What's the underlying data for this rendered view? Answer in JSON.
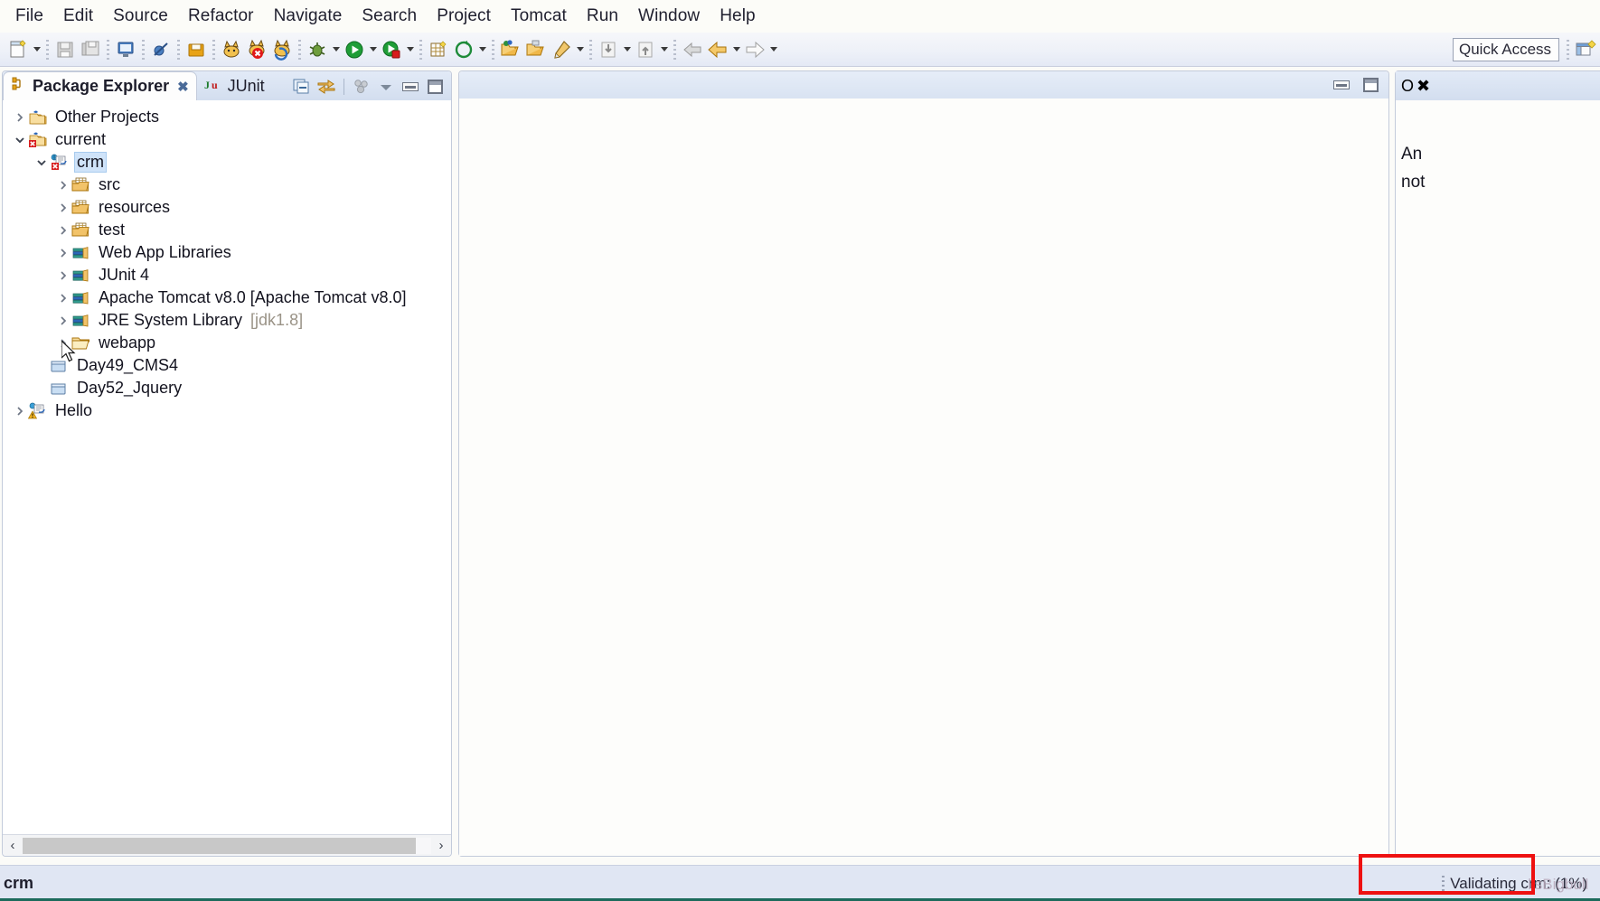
{
  "window": {
    "title_bar_visible": false
  },
  "menubar": {
    "items": [
      {
        "label": "File",
        "name": "menu-file"
      },
      {
        "label": "Edit",
        "name": "menu-edit"
      },
      {
        "label": "Source",
        "name": "menu-source"
      },
      {
        "label": "Refactor",
        "name": "menu-refactor"
      },
      {
        "label": "Navigate",
        "name": "menu-navigate"
      },
      {
        "label": "Search",
        "name": "menu-search"
      },
      {
        "label": "Project",
        "name": "menu-project"
      },
      {
        "label": "Tomcat",
        "name": "menu-tomcat"
      },
      {
        "label": "Run",
        "name": "menu-run"
      },
      {
        "label": "Window",
        "name": "menu-window"
      },
      {
        "label": "Help",
        "name": "menu-help"
      }
    ]
  },
  "toolbar": {
    "icons": [
      "new-wizard-icon",
      "dropdown-arrow",
      "separator",
      "save-icon",
      "save-all-icon",
      "separator",
      "open-console-icon",
      "separator",
      "skip-breakpoints-icon",
      "separator",
      "export-archive-icon",
      "separator",
      "tomcat-start-icon",
      "tomcat-stop-icon",
      "tomcat-restart-icon",
      "separator",
      "debug-icon",
      "dropdown-arrow",
      "run-icon",
      "dropdown-arrow",
      "run-server-icon",
      "dropdown-arrow",
      "separator",
      "new-java-package-icon",
      "new-java-class-icon",
      "dropdown-arrow",
      "separator",
      "open-type-icon",
      "open-task-icon",
      "search-icon",
      "dropdown-arrow",
      "separator",
      "previous-annotation-icon",
      "dropdown-arrow",
      "next-annotation-icon",
      "dropdown-arrow",
      "separator",
      "back-history-icon",
      "back-icon",
      "dropdown-arrow",
      "forward-icon",
      "dropdown-arrow"
    ],
    "quick_access": {
      "placeholder": "Quick Access",
      "value": "Quick Access"
    },
    "perspective_button": "open-perspective-icon"
  },
  "left_view": {
    "tabs": [
      {
        "label": "Package Explorer",
        "icon": "package-explorer-icon",
        "active": true,
        "closable": true,
        "close_glyph": "✖"
      },
      {
        "label": "JUnit",
        "icon": "junit-icon",
        "active": false,
        "closable": false
      }
    ],
    "toolbar_icons": [
      "collapse-all-icon",
      "link-with-editor-icon",
      "view-menu-icon",
      "minimize-icon",
      "maximize-icon"
    ],
    "tree": [
      {
        "label": "Other Projects",
        "indent": 0,
        "twisty": "collapsed",
        "icon": "java-project-group-icon",
        "selected": false
      },
      {
        "label": "current",
        "indent": 0,
        "twisty": "expanded",
        "icon": "java-project-group-error-icon",
        "selected": false
      },
      {
        "label": "crm",
        "indent": 1,
        "twisty": "expanded",
        "icon": "dynamic-web-project-error-icon",
        "selected": true
      },
      {
        "label": "src",
        "indent": 2,
        "twisty": "collapsed",
        "icon": "source-folder-icon",
        "selected": false
      },
      {
        "label": "resources",
        "indent": 2,
        "twisty": "collapsed",
        "icon": "source-folder-icon",
        "selected": false
      },
      {
        "label": "test",
        "indent": 2,
        "twisty": "collapsed",
        "icon": "source-folder-icon",
        "selected": false
      },
      {
        "label": "Web App Libraries",
        "indent": 2,
        "twisty": "collapsed",
        "icon": "library-icon",
        "selected": false
      },
      {
        "label": "JUnit 4",
        "indent": 2,
        "twisty": "collapsed",
        "icon": "library-icon",
        "selected": false
      },
      {
        "label": "Apache Tomcat v8.0 [Apache Tomcat v8.0]",
        "indent": 2,
        "twisty": "collapsed",
        "icon": "library-icon",
        "selected": false
      },
      {
        "label": "JRE System Library",
        "suffix": "[jdk1.8]",
        "indent": 2,
        "twisty": "collapsed",
        "icon": "library-icon",
        "selected": false
      },
      {
        "label": "webapp",
        "indent": 2,
        "twisty": "collapsed",
        "icon": "folder-icon",
        "selected": false
      },
      {
        "label": "Day49_CMS4",
        "indent": 1,
        "twisty": "none",
        "icon": "closed-project-icon",
        "selected": false
      },
      {
        "label": "Day52_Jquery",
        "indent": 1,
        "twisty": "none",
        "icon": "closed-project-icon",
        "selected": false
      },
      {
        "label": "Hello",
        "indent": 0,
        "twisty": "collapsed",
        "icon": "dynamic-web-project-warning-icon",
        "selected": false
      }
    ],
    "hscrollbar": {
      "left_arrow": "‹",
      "right_arrow": "›"
    }
  },
  "editor_area": {
    "controls": [
      "minimize-icon",
      "maximize-icon"
    ],
    "content": ""
  },
  "right_view": {
    "tab_label_partial": "O",
    "close_glyph": "✖",
    "body_lines": [
      "An",
      "not"
    ]
  },
  "statusbar": {
    "left_text": "crm",
    "progress_text": "Validating crm: (1%)",
    "watermark_text": "lisBigbull",
    "highlight_color": "#ee1111"
  },
  "colors": {
    "toolbar_bg": "#eef1f8",
    "tab_active_bg": "#fdfdfd",
    "tab_inactive_bg": "#d3deef",
    "selection_bg": "#cfe3f9",
    "status_bg": "#e0e6f3",
    "accent_red": "#ee1111",
    "dim_text": "#9a9387"
  }
}
